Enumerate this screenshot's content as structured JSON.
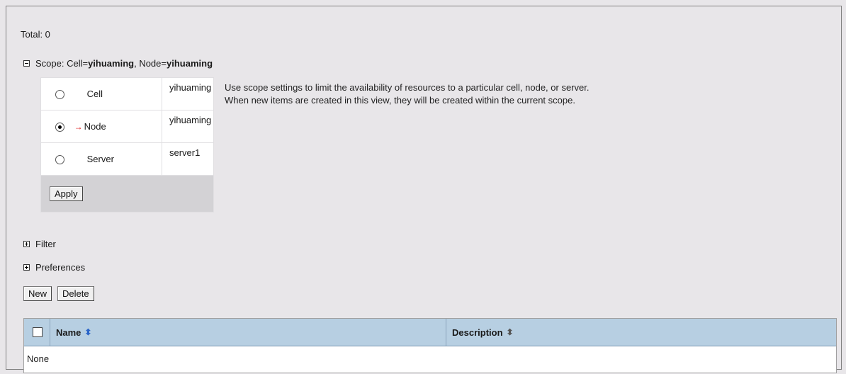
{
  "total": "Total: 0",
  "scope": {
    "prefix": "Scope: Cell=",
    "cell_name": "yihuaming",
    "node_sep": ", Node=",
    "node_name": "yihuaming",
    "options": [
      {
        "label": "Cell",
        "value": "yihuaming",
        "selected": false
      },
      {
        "label": "Node",
        "value": "yihuaming",
        "selected": true,
        "arrow": "→"
      },
      {
        "label": "Server",
        "value": "server1",
        "selected": false
      }
    ],
    "apply_label": "Apply",
    "description_line1": "Use scope settings to limit the availability of resources to a particular cell, node, or server.",
    "description_line2": "When new items are created in this view, they will be created within the current scope."
  },
  "filter_label": "Filter",
  "preferences_label": "Preferences",
  "toolbar": {
    "new_label": "New",
    "delete_label": "Delete"
  },
  "table": {
    "columns": [
      {
        "label": "Name",
        "sort_icon": "sort-up-icon"
      },
      {
        "label": "Description",
        "sort_icon": "sort-icon"
      }
    ],
    "empty_text": "None"
  },
  "colors": {
    "header_bg": "#b7cfe2",
    "page_bg": "#e8e6e9",
    "arrow": "#dd1111"
  }
}
